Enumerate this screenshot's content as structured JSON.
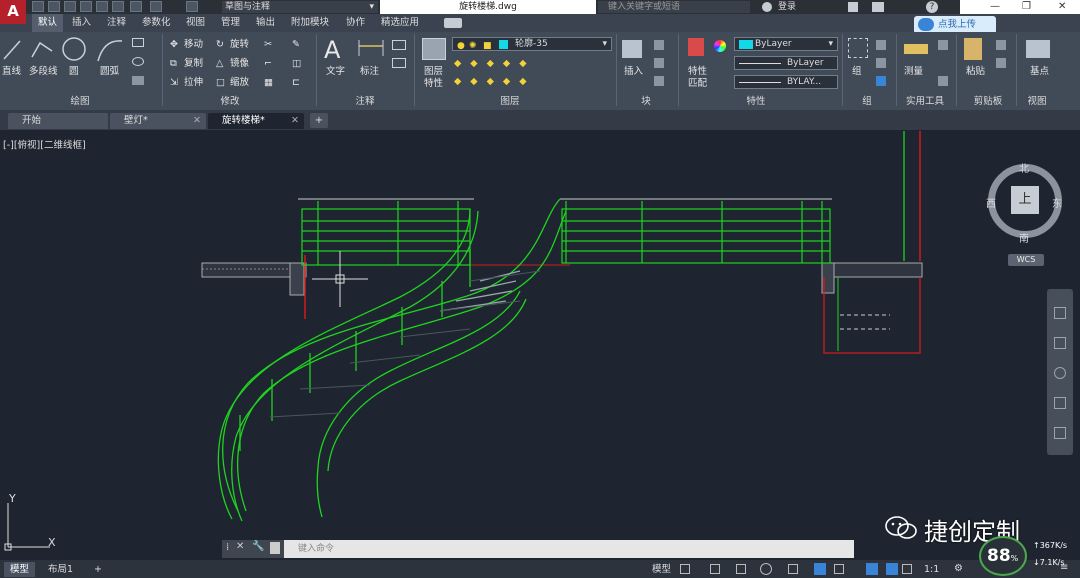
{
  "titlebar": {
    "app_logo": "A",
    "workspace": "草图与注释",
    "filename": "旋转楼梯.dwg",
    "search_placeholder": "键入关键字或短语",
    "login": "登录"
  },
  "tabs": [
    "默认",
    "插入",
    "注释",
    "参数化",
    "视图",
    "管理",
    "输出",
    "附加模块",
    "协作",
    "精选应用"
  ],
  "upload_button": "点我上传",
  "ribbon": {
    "draw": {
      "label": "绘图",
      "tools": [
        "直线",
        "多段线",
        "圆",
        "圆弧"
      ]
    },
    "modify": {
      "label": "修改",
      "tools": [
        "移动",
        "旋转",
        "复制",
        "镜像",
        "拉伸",
        "缩放"
      ]
    },
    "annotation": {
      "label": "注释",
      "tools": [
        "文字",
        "标注"
      ]
    },
    "layers": {
      "label": "图层",
      "tools": [
        "图层特性"
      ],
      "current_layer": "轮廓-35"
    },
    "block": {
      "label": "块",
      "tools": [
        "插入"
      ]
    },
    "properties": {
      "label": "特性",
      "tools": [
        "特性匹配"
      ],
      "color": "ByLayer",
      "linetype": "ByLayer",
      "lineweight": "BYLAY..."
    },
    "groups": {
      "label": "组",
      "tools": [
        "组"
      ]
    },
    "utilities": {
      "label": "实用工具",
      "tools": [
        "测量"
      ]
    },
    "clipboard": {
      "label": "剪贴板",
      "tools": [
        "粘贴"
      ]
    },
    "view": {
      "label": "视图",
      "tools": [
        "基点"
      ]
    }
  },
  "doc_tabs": [
    "开始",
    "壁灯*",
    "旋转楼梯*"
  ],
  "viewport_label": "[-][俯视][二维线框]",
  "navcube": {
    "top": "上",
    "north": "北",
    "south": "南",
    "east": "东",
    "west": "西",
    "wcs": "WCS"
  },
  "ucs": {
    "x": "X",
    "y": "Y"
  },
  "command_line": {
    "placeholder": "键入命令"
  },
  "layout_tabs": [
    "模型",
    "布局1"
  ],
  "status": {
    "model": "模型",
    "scale": "1:1"
  },
  "watermark": "捷创定制",
  "perf": {
    "percent": "88",
    "unit": "%",
    "up": "367",
    "down": "7.1",
    "speed_unit": "K/s"
  },
  "colors": {
    "rail": "#1fd31f",
    "wall": "#d21b1b",
    "background": "#1e2530"
  }
}
